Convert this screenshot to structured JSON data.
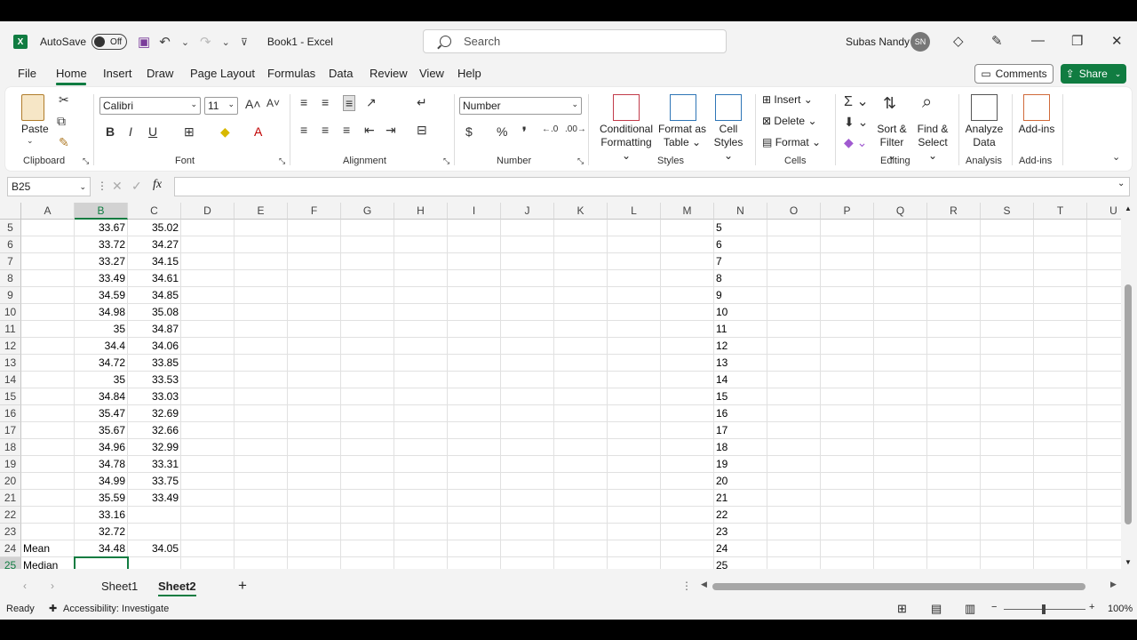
{
  "titlebar": {
    "app_icon": "X",
    "autosave_label": "AutoSave",
    "toggle_state": "Off",
    "doc_title": "Book1  -  Excel",
    "search_placeholder": "Search",
    "user_name": "Subas Nandy",
    "user_initials": "SN"
  },
  "menu": [
    "File",
    "Home",
    "Insert",
    "Draw",
    "Page Layout",
    "Formulas",
    "Data",
    "Review",
    "View",
    "Help"
  ],
  "actions": {
    "comments": "Comments",
    "share": "Share"
  },
  "ribbon": {
    "clipboard": {
      "paste": "Paste",
      "group": "Clipboard"
    },
    "font": {
      "name": "Calibri",
      "size": "11",
      "group": "Font"
    },
    "alignment": {
      "group": "Alignment"
    },
    "number": {
      "format": "Number",
      "group": "Number"
    },
    "styles": {
      "conditional_1": "Conditional",
      "conditional_2": "Formatting",
      "format_as_1": "Format as",
      "format_as_2": "Table",
      "cell_styles_1": "Cell",
      "cell_styles_2": "Styles",
      "group": "Styles"
    },
    "cells": {
      "insert": "Insert",
      "delete": "Delete",
      "format": "Format",
      "group": "Cells"
    },
    "editing": {
      "sort_1": "Sort &",
      "sort_2": "Filter",
      "find_1": "Find &",
      "find_2": "Select",
      "group": "Editing"
    },
    "analysis": {
      "analyze_1": "Analyze",
      "analyze_2": "Data",
      "group": "Analysis"
    },
    "addins": {
      "label": "Add-ins",
      "group": "Add-ins"
    }
  },
  "formula_bar": {
    "name_box": "B25",
    "fx": "fx",
    "value": ""
  },
  "columns": [
    "A",
    "B",
    "C",
    "D",
    "E",
    "F",
    "G",
    "H",
    "I",
    "J",
    "K",
    "L",
    "M",
    "N",
    "O",
    "P",
    "Q",
    "R",
    "S",
    "T",
    "U"
  ],
  "rows": [
    {
      "n": "5",
      "a": "",
      "b": "33.67",
      "c": "35.02"
    },
    {
      "n": "6",
      "a": "",
      "b": "33.72",
      "c": "34.27"
    },
    {
      "n": "7",
      "a": "",
      "b": "33.27",
      "c": "34.15"
    },
    {
      "n": "8",
      "a": "",
      "b": "33.49",
      "c": "34.61"
    },
    {
      "n": "9",
      "a": "",
      "b": "34.59",
      "c": "34.85"
    },
    {
      "n": "10",
      "a": "",
      "b": "34.98",
      "c": "35.08"
    },
    {
      "n": "11",
      "a": "",
      "b": "35",
      "c": "34.87"
    },
    {
      "n": "12",
      "a": "",
      "b": "34.4",
      "c": "34.06"
    },
    {
      "n": "13",
      "a": "",
      "b": "34.72",
      "c": "33.85"
    },
    {
      "n": "14",
      "a": "",
      "b": "35",
      "c": "33.53"
    },
    {
      "n": "15",
      "a": "",
      "b": "34.84",
      "c": "33.03"
    },
    {
      "n": "16",
      "a": "",
      "b": "35.47",
      "c": "32.69"
    },
    {
      "n": "17",
      "a": "",
      "b": "35.67",
      "c": "32.66"
    },
    {
      "n": "18",
      "a": "",
      "b": "34.96",
      "c": "32.99"
    },
    {
      "n": "19",
      "a": "",
      "b": "34.78",
      "c": "33.31"
    },
    {
      "n": "20",
      "a": "",
      "b": "34.99",
      "c": "33.75"
    },
    {
      "n": "21",
      "a": "",
      "b": "35.59",
      "c": "33.49"
    },
    {
      "n": "22",
      "a": "",
      "b": "33.16",
      "c": ""
    },
    {
      "n": "23",
      "a": "",
      "b": "32.72",
      "c": ""
    },
    {
      "n": "24",
      "a": "Mean",
      "b": "34.48",
      "c": "34.05"
    },
    {
      "n": "25",
      "a": "Median",
      "b": "",
      "c": ""
    }
  ],
  "sheets": [
    "Sheet1",
    "Sheet2"
  ],
  "active_sheet": "Sheet2",
  "status": {
    "ready": "Ready",
    "accessibility": "Accessibility: Investigate",
    "zoom": "100%"
  },
  "colors": {
    "excel_green": "#107c41"
  }
}
